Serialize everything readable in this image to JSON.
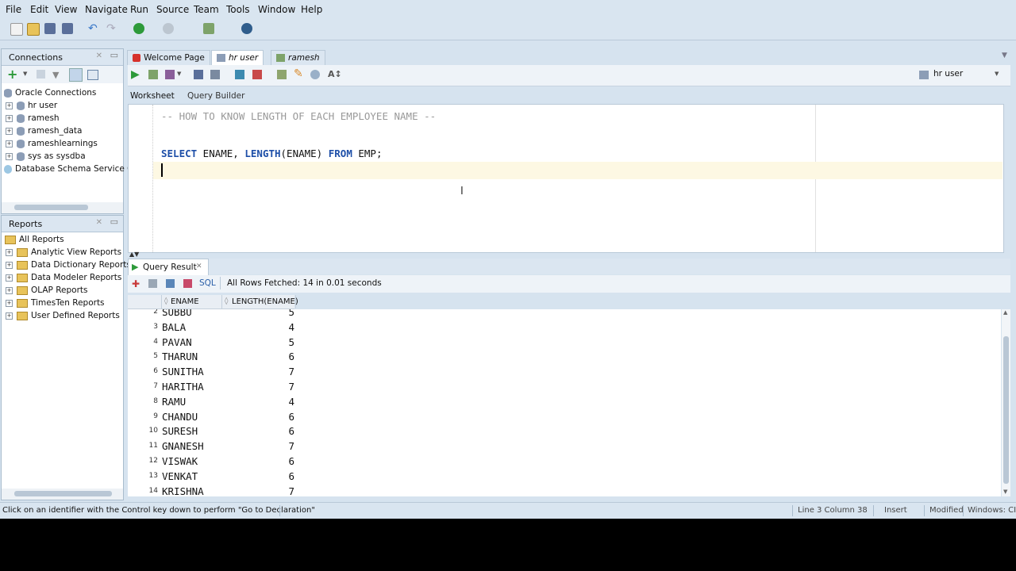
{
  "menu": [
    "File",
    "Edit",
    "View",
    "Navigate",
    "Run",
    "Source",
    "Team",
    "Tools",
    "Window",
    "Help"
  ],
  "connections": {
    "title": "Connections",
    "root": "Oracle Connections",
    "items": [
      "hr user",
      "ramesh",
      "ramesh_data",
      "rameshlearnings",
      "sys as sysdba"
    ],
    "extra": "Database Schema Service Cor"
  },
  "reports": {
    "title": "Reports",
    "root": "All Reports",
    "items": [
      "Analytic View Reports",
      "Data Dictionary Reports",
      "Data Modeler Reports",
      "OLAP Reports",
      "TimesTen Reports",
      "User Defined Reports"
    ]
  },
  "tabs": [
    "Welcome Page",
    "hr user",
    "ramesh"
  ],
  "connection_selector": "hr user",
  "subtabs": [
    "Worksheet",
    "Query Builder"
  ],
  "editor": {
    "comment": "-- HOW TO KNOW LENGTH OF EACH EMPLOYEE NAME --",
    "kw_select": "SELECT",
    "part1": " ENAME, ",
    "kw_length": "LENGTH",
    "part2": "(ENAME) ",
    "kw_from": "FROM",
    "part3": " EMP;"
  },
  "result": {
    "tab": "Query Result",
    "sql_label": "SQL",
    "status": "All Rows Fetched: 14 in 0.01 seconds",
    "columns": [
      "ENAME",
      "LENGTH(ENAME)"
    ],
    "rows": [
      {
        "n": "2",
        "name": "SUBBU",
        "len": "5"
      },
      {
        "n": "3",
        "name": "BALA",
        "len": "4"
      },
      {
        "n": "4",
        "name": "PAVAN",
        "len": "5"
      },
      {
        "n": "5",
        "name": "THARUN",
        "len": "6"
      },
      {
        "n": "6",
        "name": "SUNITHA",
        "len": "7"
      },
      {
        "n": "7",
        "name": "HARITHA",
        "len": "7"
      },
      {
        "n": "8",
        "name": "RAMU",
        "len": "4"
      },
      {
        "n": "9",
        "name": "CHANDU",
        "len": "6"
      },
      {
        "n": "10",
        "name": "SURESH",
        "len": "6"
      },
      {
        "n": "11",
        "name": "GNANESH",
        "len": "7"
      },
      {
        "n": "12",
        "name": "VISWAK",
        "len": "6"
      },
      {
        "n": "13",
        "name": "VENKAT",
        "len": "6"
      },
      {
        "n": "14",
        "name": "KRISHNA",
        "len": "7"
      }
    ]
  },
  "statusbar": {
    "hint": "Click on an identifier with the Control key down to perform \"Go to Declaration\"",
    "position": "Line 3 Column 38",
    "mode": "Insert",
    "modified": "Modified",
    "os": "Windows: CI"
  }
}
